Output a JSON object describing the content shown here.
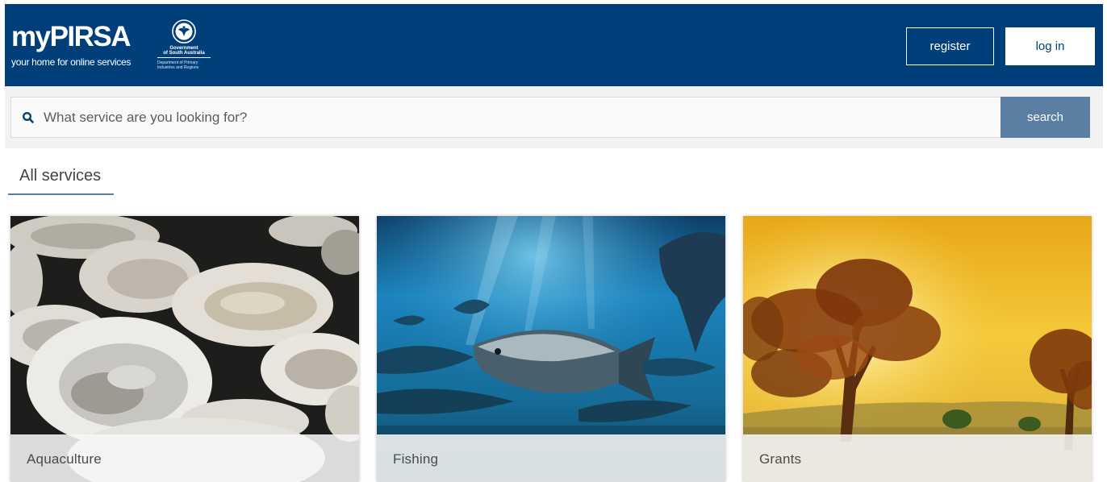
{
  "header": {
    "brand": {
      "title": "myPIRSA",
      "tagline": "your home for online services"
    },
    "gov_logo": {
      "name_line1": "Government",
      "name_line2": "of South Australia",
      "dept_line1": "Department of Primary",
      "dept_line2": "Industries and Regions"
    },
    "register_label": "register",
    "login_label": "log in",
    "background_color": "#003f7a"
  },
  "search": {
    "placeholder": "What service are you looking for?",
    "value": "",
    "button_label": "search",
    "icon": "search-icon",
    "button_color": "#5b7fa3"
  },
  "services": {
    "title": "All services",
    "cards": [
      {
        "label": "Aquaculture",
        "image": "oysters"
      },
      {
        "label": "Fishing",
        "image": "tuna-underwater"
      },
      {
        "label": "Grants",
        "image": "sunset-trees"
      }
    ]
  }
}
